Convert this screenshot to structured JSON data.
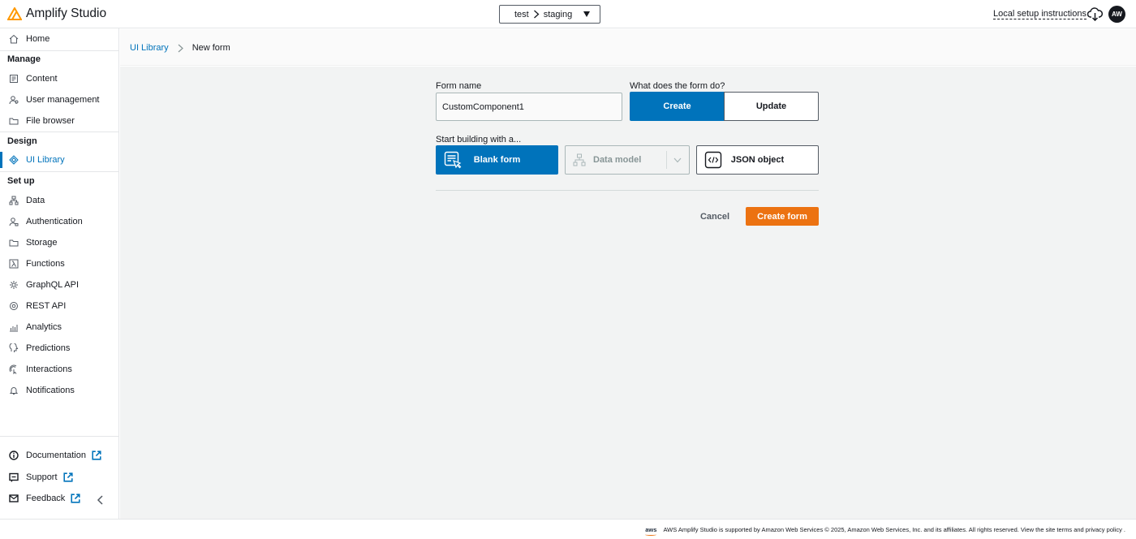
{
  "app": {
    "title": "Amplify Studio",
    "brand_color": "#ff9900"
  },
  "header": {
    "env_app": "test",
    "env_branch": "staging",
    "setup_link": "Local setup instructions",
    "avatar_initials": "AW"
  },
  "sidebar": {
    "home": "Home",
    "manage_title": "Manage",
    "manage_items": [
      "Content",
      "User management",
      "File browser"
    ],
    "design_title": "Design",
    "design_items": [
      "UI Library"
    ],
    "setup_title": "Set up",
    "setup_items": [
      "Data",
      "Authentication",
      "Storage",
      "Functions",
      "GraphQL API",
      "REST API",
      "Analytics",
      "Predictions",
      "Interactions",
      "Notifications"
    ],
    "bottom_items": [
      "Documentation",
      "Support",
      "Feedback"
    ],
    "active_item": "UI Library"
  },
  "breadcrumb": {
    "parent": "UI Library",
    "current": "New form"
  },
  "form": {
    "name_label": "Form name",
    "name_value": "CustomComponent1",
    "purpose_label": "What does the form do?",
    "purpose_options": [
      "Create",
      "Update"
    ],
    "purpose_selected": "Create",
    "start_label": "Start building with a...",
    "start_options": {
      "blank": "Blank form",
      "data_model": "Data model",
      "json": "JSON object"
    },
    "start_selected": "Blank form",
    "cancel": "Cancel",
    "submit": "Create form"
  },
  "footer": {
    "aws": "aws",
    "text": "AWS Amplify Studio is supported by Amazon Web Services © 2025, Amazon Web Services, Inc. and its affiliates. All rights reserved. View the site terms and privacy policy ."
  },
  "colors": {
    "primary": "#0073bb",
    "accent": "#ec7211",
    "text": "#16191f"
  }
}
